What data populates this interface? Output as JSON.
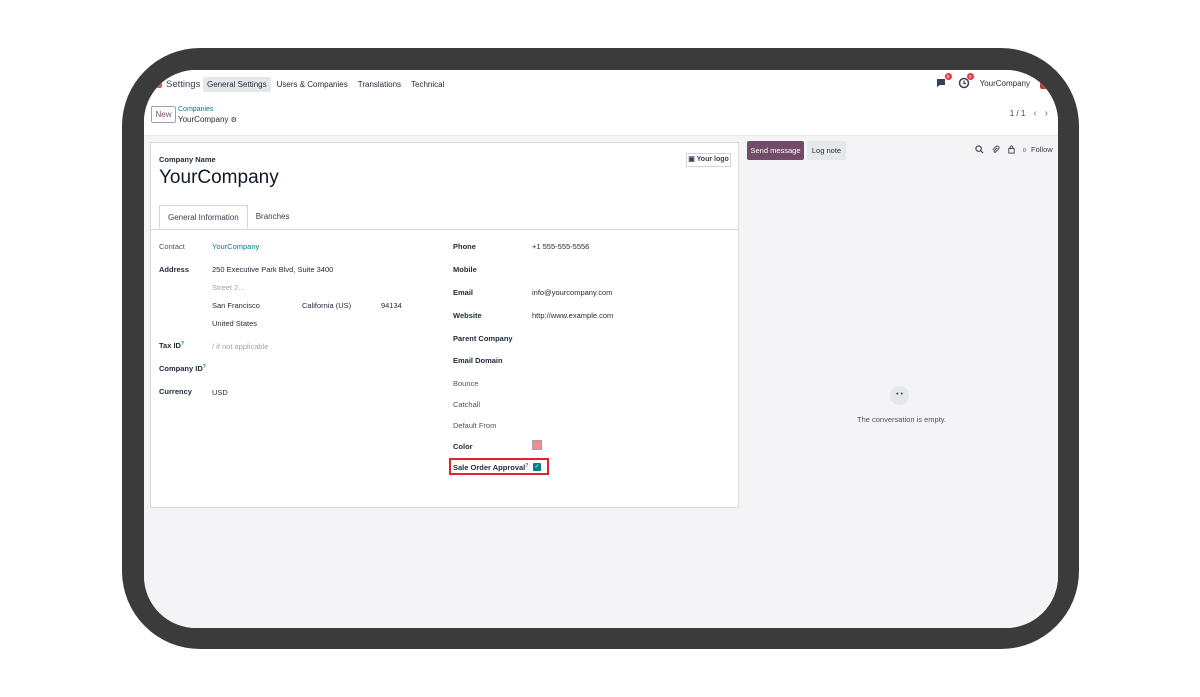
{
  "app": {
    "name": "Settings"
  },
  "menu": [
    "General Settings",
    "Users & Companies",
    "Translations",
    "Technical"
  ],
  "navbar": {
    "messages_count": "8",
    "activities_count": "2",
    "company": "YourCompany"
  },
  "control": {
    "new_label": "New",
    "breadcrumb_parent": "Companies",
    "breadcrumb_current": "YourCompany",
    "pager": "1 / 1"
  },
  "form": {
    "company_name_label": "Company Name",
    "company_name": "YourCompany",
    "logo_label": "Your logo",
    "tabs": [
      "General Information",
      "Branches"
    ],
    "left": {
      "contact_label": "Contact",
      "contact": "YourCompany",
      "address_label": "Address",
      "street": "250 Executive Park Blvd, Suite 3400",
      "street2": "Street 2...",
      "city": "San Francisco",
      "state": "California (US)",
      "zip": "94134",
      "country": "United States",
      "tax_id_label": "Tax ID",
      "tax_id_placeholder": "/ if not applicable",
      "company_id_label": "Company ID",
      "currency_label": "Currency",
      "currency": "USD"
    },
    "right": {
      "phone_label": "Phone",
      "phone": "+1 555-555-5556",
      "mobile_label": "Mobile",
      "email_label": "Email",
      "email": "info@yourcompany.com",
      "website_label": "Website",
      "website": "http://www.example.com",
      "parent_company_label": "Parent Company",
      "email_domain_label": "Email Domain",
      "bounce_label": "Bounce",
      "catchall_label": "Catchall",
      "default_from_label": "Default From",
      "color_label": "Color",
      "color_value": "#f28b8b",
      "sale_order_approval_label": "Sale Order Approval",
      "sale_order_approval_checked": true
    }
  },
  "chatter": {
    "send_message": "Send message",
    "log_note": "Log note",
    "followers_count": "0",
    "follow": "Follow",
    "empty_text": "The conversation is empty."
  },
  "colors": {
    "brand": "#714b67",
    "link": "#017e84",
    "highlight": "#e0242d"
  }
}
